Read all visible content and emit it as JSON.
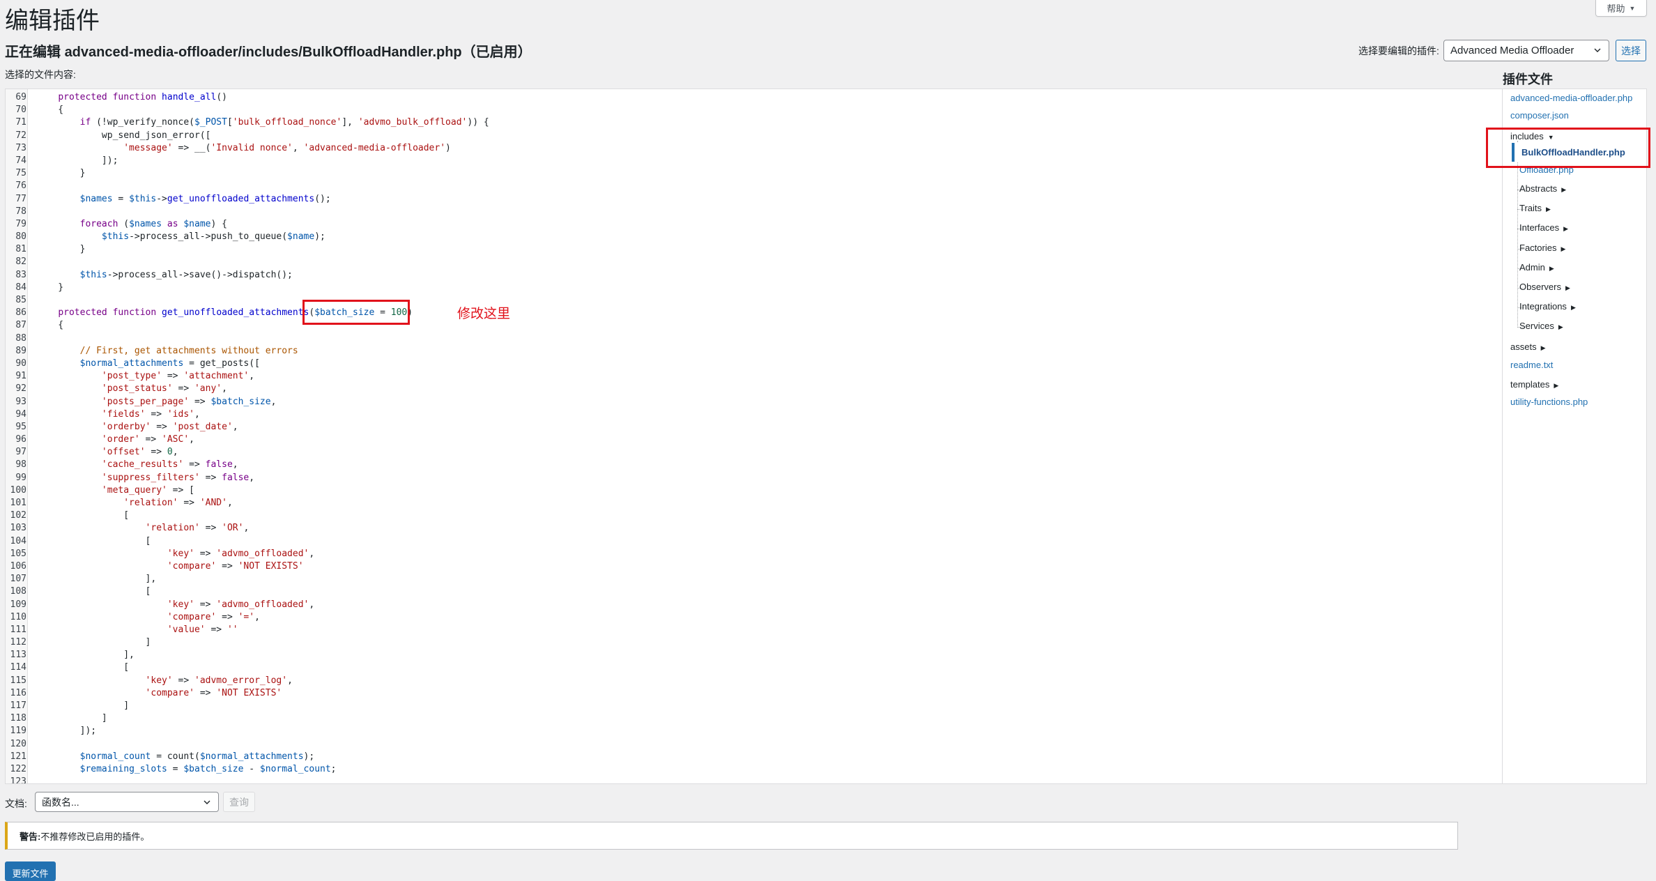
{
  "header": {
    "help_tab": "帮助",
    "page_title": "编辑插件",
    "editing_prefix": "正在编辑 ",
    "editing_file": "advanced-media-offloader/includes/BulkOffloadHandler.php",
    "editing_status": "（已启用）",
    "selected_content_label": "选择的文件内容:"
  },
  "plugin_selector": {
    "label": "选择要编辑的插件:",
    "value": "Advanced Media Offloader",
    "button": "选择"
  },
  "editor": {
    "annotation_note": "修改这里",
    "code_lines": [
      {
        "n": "69",
        "t": "    protected function handle_all()"
      },
      {
        "n": "70",
        "t": "    {"
      },
      {
        "n": "71",
        "t": "        if (!wp_verify_nonce($_POST['bulk_offload_nonce'], 'advmo_bulk_offload')) {"
      },
      {
        "n": "72",
        "t": "            wp_send_json_error(["
      },
      {
        "n": "73",
        "t": "                'message' => __('Invalid nonce', 'advanced-media-offloader')"
      },
      {
        "n": "74",
        "t": "            ]);"
      },
      {
        "n": "75",
        "t": "        }"
      },
      {
        "n": "76",
        "t": ""
      },
      {
        "n": "77",
        "t": "        $names = $this->get_unoffloaded_attachments();"
      },
      {
        "n": "78",
        "t": ""
      },
      {
        "n": "79",
        "t": "        foreach ($names as $name) {"
      },
      {
        "n": "80",
        "t": "            $this->process_all->push_to_queue($name);"
      },
      {
        "n": "81",
        "t": "        }"
      },
      {
        "n": "82",
        "t": ""
      },
      {
        "n": "83",
        "t": "        $this->process_all->save()->dispatch();"
      },
      {
        "n": "84",
        "t": "    }"
      },
      {
        "n": "85",
        "t": ""
      },
      {
        "n": "86",
        "t": "    protected function get_unoffloaded_attachments($batch_size = 100)"
      },
      {
        "n": "87",
        "t": "    {"
      },
      {
        "n": "88",
        "t": ""
      },
      {
        "n": "89",
        "t": "        // First, get attachments without errors"
      },
      {
        "n": "90",
        "t": "        $normal_attachments = get_posts(["
      },
      {
        "n": "91",
        "t": "            'post_type' => 'attachment',"
      },
      {
        "n": "92",
        "t": "            'post_status' => 'any',"
      },
      {
        "n": "93",
        "t": "            'posts_per_page' => $batch_size,"
      },
      {
        "n": "94",
        "t": "            'fields' => 'ids',"
      },
      {
        "n": "95",
        "t": "            'orderby' => 'post_date',"
      },
      {
        "n": "96",
        "t": "            'order' => 'ASC',"
      },
      {
        "n": "97",
        "t": "            'offset' => 0,"
      },
      {
        "n": "98",
        "t": "            'cache_results' => false,"
      },
      {
        "n": "99",
        "t": "            'suppress_filters' => false,"
      },
      {
        "n": "100",
        "t": "            'meta_query' => ["
      },
      {
        "n": "101",
        "t": "                'relation' => 'AND',"
      },
      {
        "n": "102",
        "t": "                ["
      },
      {
        "n": "103",
        "t": "                    'relation' => 'OR',"
      },
      {
        "n": "104",
        "t": "                    ["
      },
      {
        "n": "105",
        "t": "                        'key' => 'advmo_offloaded',"
      },
      {
        "n": "106",
        "t": "                        'compare' => 'NOT EXISTS'"
      },
      {
        "n": "107",
        "t": "                    ],"
      },
      {
        "n": "108",
        "t": "                    ["
      },
      {
        "n": "109",
        "t": "                        'key' => 'advmo_offloaded',"
      },
      {
        "n": "110",
        "t": "                        'compare' => '=',"
      },
      {
        "n": "111",
        "t": "                        'value' => ''"
      },
      {
        "n": "112",
        "t": "                    ]"
      },
      {
        "n": "113",
        "t": "                ],"
      },
      {
        "n": "114",
        "t": "                ["
      },
      {
        "n": "115",
        "t": "                    'key' => 'advmo_error_log',"
      },
      {
        "n": "116",
        "t": "                    'compare' => 'NOT EXISTS'"
      },
      {
        "n": "117",
        "t": "                ]"
      },
      {
        "n": "118",
        "t": "            ]"
      },
      {
        "n": "119",
        "t": "        ]);"
      },
      {
        "n": "120",
        "t": ""
      },
      {
        "n": "121",
        "t": "        $normal_count = count($normal_attachments);"
      },
      {
        "n": "122",
        "t": "        $remaining_slots = $batch_size - $normal_count;"
      },
      {
        "n": "123",
        "t": ""
      }
    ]
  },
  "file_tree": {
    "title": "插件文件",
    "root_files": [
      "advanced-media-offloader.php",
      "composer.json"
    ],
    "includes_folder": "includes",
    "current_file": "BulkOffloadHandler.php",
    "offloader_file": "Offloader.php",
    "includes_subfolders": [
      "Abstracts",
      "Traits",
      "Interfaces",
      "Factories",
      "Admin",
      "Observers",
      "Integrations",
      "Services"
    ],
    "assets_folder": "assets",
    "readme_file": "readme.txt",
    "templates_folder": "templates",
    "utility_file": "utility-functions.php"
  },
  "footer": {
    "doc_label": "文档:",
    "function_select_placeholder": "函数名...",
    "lookup_button": "查询",
    "notice_strong": "警告:",
    "notice_text": "不推荐修改已启用的插件。",
    "update_button": "更新文件"
  },
  "colors": {
    "accent": "#2271b1",
    "annotation": "#e1121b",
    "warning_border": "#dba617"
  }
}
